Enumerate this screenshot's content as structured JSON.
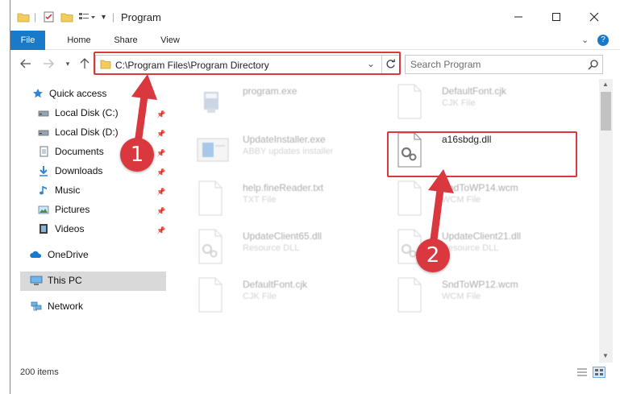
{
  "window": {
    "title": "Program"
  },
  "ribbon": {
    "tabs": [
      "File",
      "Home",
      "Share",
      "View"
    ]
  },
  "address": {
    "path": "C:\\Program Files\\Program Directory"
  },
  "search": {
    "placeholder": "Search Program"
  },
  "sidebar": {
    "quick_access": "Quick access",
    "items": [
      {
        "label": "Local Disk (C:)",
        "icon": "drive-icon",
        "pinned": true
      },
      {
        "label": "Local Disk (D:)",
        "icon": "drive-icon",
        "pinned": true
      },
      {
        "label": "Documents",
        "icon": "documents-icon",
        "pinned": true
      },
      {
        "label": "Downloads",
        "icon": "downloads-icon",
        "pinned": true
      },
      {
        "label": "Music",
        "icon": "music-icon",
        "pinned": true
      },
      {
        "label": "Pictures",
        "icon": "pictures-icon",
        "pinned": true
      },
      {
        "label": "Videos",
        "icon": "videos-icon",
        "pinned": true
      }
    ],
    "onedrive": "OneDrive",
    "thispc": "This PC",
    "network": "Network"
  },
  "files": [
    {
      "name": "program.exe",
      "type": ""
    },
    {
      "name": "DefaultFont.cjk",
      "type": "CJK File"
    },
    {
      "name": "UpdateInstaller.exe",
      "type": "ABBY updates installer"
    },
    {
      "name": "a16sbdg.dll",
      "type": ""
    },
    {
      "name": "help.fineReader.txt",
      "type": "TXT File"
    },
    {
      "name": "SndToWP14.wcm",
      "type": "WCM File"
    },
    {
      "name": "UpdateClient65.dll",
      "type": "Resource DLL"
    },
    {
      "name": "UpdateClient21.dll",
      "type": "Resource DLL"
    },
    {
      "name": "DefaultFont.cjk",
      "type": "CJK File"
    },
    {
      "name": "SndToWP12.wcm",
      "type": "WCM File"
    }
  ],
  "status": {
    "items": "200 items"
  },
  "badges": {
    "one": "1",
    "two": "2"
  },
  "colors": {
    "accent": "#1979ca",
    "highlight": "#d9383f",
    "selected": "#d9d9d9"
  }
}
